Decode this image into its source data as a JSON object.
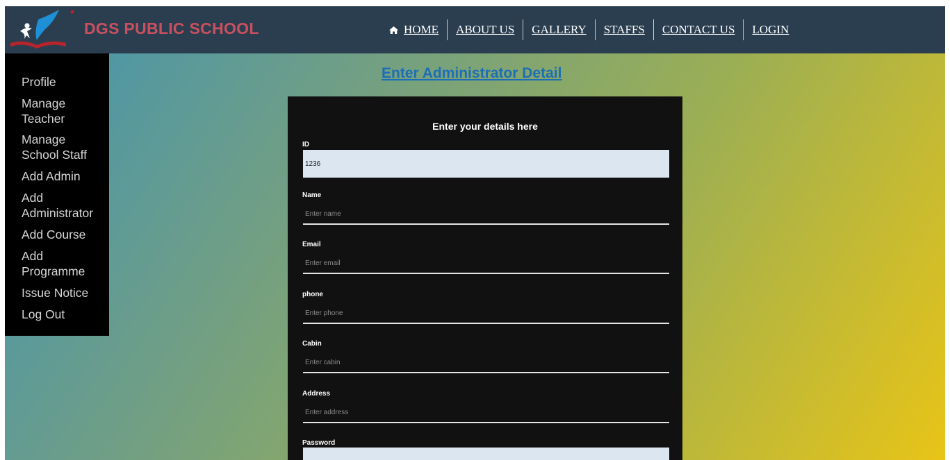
{
  "header": {
    "brand": "DGS PUBLIC SCHOOL",
    "nav": [
      {
        "label": "HOME",
        "icon": "home-icon"
      },
      {
        "label": "ABOUT US"
      },
      {
        "label": "GALLERY"
      },
      {
        "label": "STAFFS"
      },
      {
        "label": "CONTACT US"
      },
      {
        "label": "LOGIN"
      }
    ]
  },
  "sidebar": {
    "items": [
      {
        "label": "Profile"
      },
      {
        "label": "Manage Teacher"
      },
      {
        "label": "Manage School Staff"
      },
      {
        "label": "Add Admin"
      },
      {
        "label": "Add Administrator"
      },
      {
        "label": "Add Course"
      },
      {
        "label": "Add Programme"
      },
      {
        "label": "Issue Notice"
      },
      {
        "label": "Log Out"
      }
    ]
  },
  "main": {
    "title": "Enter Administrator Detail",
    "form": {
      "heading": "Enter your details here",
      "fields": [
        {
          "label": "ID",
          "value": "1236",
          "placeholder": ""
        },
        {
          "label": "Name",
          "value": "",
          "placeholder": "Enter name"
        },
        {
          "label": "Email",
          "value": "",
          "placeholder": "Enter email"
        },
        {
          "label": "phone",
          "value": "",
          "placeholder": "Enter phone"
        },
        {
          "label": "Cabin",
          "value": "",
          "placeholder": "Enter cabin"
        },
        {
          "label": "Address",
          "value": "",
          "placeholder": "Enter address"
        },
        {
          "label": "Password",
          "value": "",
          "placeholder": ""
        }
      ]
    }
  },
  "colors": {
    "navbar": "#2b3e50",
    "brand": "#c9505e",
    "title": "#1c6fb6",
    "sidebar": "#000000",
    "card": "#111111",
    "input_fill": "#dce6f0"
  }
}
